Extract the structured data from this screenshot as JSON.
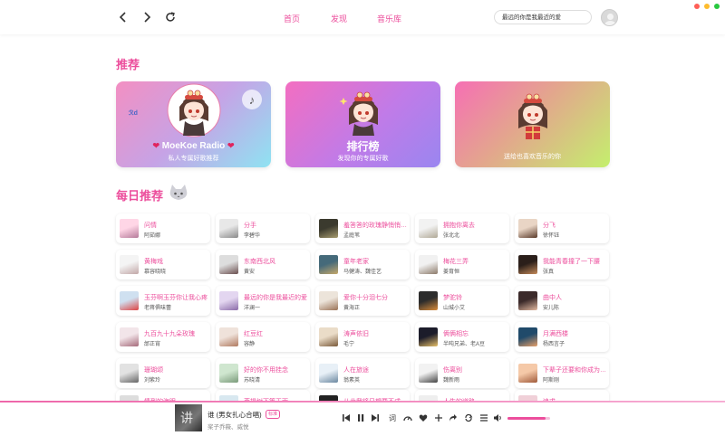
{
  "nav": {
    "tabs": [
      "首页",
      "发现",
      "音乐库"
    ],
    "search_value": "最远的你是我最近的爱"
  },
  "recommend": {
    "title": "推荐",
    "cards": [
      {
        "title": "MoeKoe Radio",
        "subtitle": "私人专属好歌推荐"
      },
      {
        "title": "排行榜",
        "subtitle": "发现你的专属好歌"
      },
      {
        "title": "",
        "subtitle": "送给也喜欢音乐的你"
      }
    ]
  },
  "daily": {
    "title": "每日推荐",
    "songs": [
      {
        "name": "问情",
        "artist": "阿茹娜"
      },
      {
        "name": "分手",
        "artist": "李碧华"
      },
      {
        "name": "羞答答的玫瑰静悄悄地开",
        "artist": "孟庭苇"
      },
      {
        "name": "拥抱你离去",
        "artist": "张北北"
      },
      {
        "name": "分飞",
        "artist": "徐怀钰"
      },
      {
        "name": "黄梅戏",
        "artist": "慕容晓晓"
      },
      {
        "name": "东南西北风",
        "artist": "黄安"
      },
      {
        "name": "童年老家",
        "artist": "马健涛、魏佳艺"
      },
      {
        "name": "梅花三弄",
        "artist": "姜育恒"
      },
      {
        "name": "我能青春撞了一下腰",
        "artist": "张真"
      },
      {
        "name": "玉芬啊玉芬你让我心疼",
        "artist": "老蒋俱味蕾"
      },
      {
        "name": "最远的你是我最近的爱",
        "artist": "洋澜一"
      },
      {
        "name": "爱你十分泪七分",
        "artist": "黄海正"
      },
      {
        "name": "梦驼铃",
        "artist": "山城小艾"
      },
      {
        "name": "曲中人",
        "artist": "安儿陈"
      },
      {
        "name": "九百九十九朵玫瑰",
        "artist": "邰正宵"
      },
      {
        "name": "红豆红",
        "artist": "容静"
      },
      {
        "name": "涛声依旧",
        "artist": "毛宁"
      },
      {
        "name": "俩俩相忘",
        "artist": "半吨兄弟、老A豆"
      },
      {
        "name": "月满西楼",
        "artist": "杨西言子"
      },
      {
        "name": "珊瑚颂",
        "artist": "刘紫玲"
      },
      {
        "name": "好的你不用挂念",
        "artist": "苏晓清"
      },
      {
        "name": "人在旅途",
        "artist": "翁素英"
      },
      {
        "name": "伤离别",
        "artist": "魏新雨"
      },
      {
        "name": "下辈子还要和你成为一家人",
        "artist": "阿斯刚"
      },
      {
        "name": "情到的海眼",
        "artist": ""
      },
      {
        "name": "菩提树下等天雨",
        "artist": ""
      },
      {
        "name": "从此我将只想要不成",
        "artist": ""
      },
      {
        "name": "人生的道路",
        "artist": ""
      },
      {
        "name": "追求",
        "artist": ""
      }
    ]
  },
  "player": {
    "title": "谁 (男女扎心合唱)",
    "tag": "标准",
    "artist": "桨子乔薇、威悦",
    "lyric_btn": "词",
    "volume": 0.9
  },
  "colors": {
    "accent": "#ec4e9c"
  }
}
